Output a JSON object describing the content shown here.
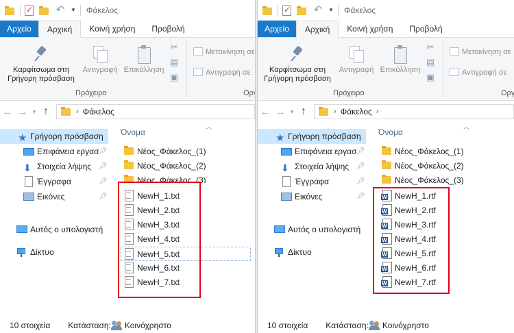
{
  "windows": [
    {
      "id": "left",
      "title": "Φάκελος",
      "tabs": [
        "Αρχείο",
        "Αρχική",
        "Κοινή χρήση",
        "Προβολή"
      ],
      "ribbon": {
        "pin_line1": "Καρφίτσωμα στη",
        "pin_line2": "Γρήγορη πρόσβαση",
        "copy": "Αντιγραφή",
        "paste": "Επικόλληση",
        "move_to": "Μετακίνηση σε",
        "copy_to": "Αντιγραφή σε",
        "group_clipboard": "Πρόχειρο",
        "group_organize": "Οργ"
      },
      "address": {
        "crumb": "Φάκελος",
        "trailing_chevron": false
      },
      "nav": [
        {
          "label": "Γρήγορη πρόσβαση",
          "icon": "star-icon",
          "pinned": false,
          "selected": true
        },
        {
          "label": "Επιφάνεια εργασ",
          "icon": "desktop-icon",
          "pinned": true
        },
        {
          "label": "Στοιχεία λήψης",
          "icon": "download-icon",
          "pinned": true
        },
        {
          "label": "Έγγραφα",
          "icon": "documents-icon",
          "pinned": true
        },
        {
          "label": "Εικόνες",
          "icon": "pictures-icon",
          "pinned": true
        },
        {
          "label": "Αυτός ο υπολογιστή",
          "icon": "computer-icon",
          "pinned": false
        },
        {
          "label": "Δίκτυο",
          "icon": "network-icon",
          "pinned": false
        }
      ],
      "column_header": "Όνομα",
      "folders": [
        "Νέος_Φάκελος_(1)",
        "Νέος_Φάκελος_(2)",
        "Νέος_Φάκελος_(3)"
      ],
      "files": [
        "NewH_1.txt",
        "NewH_2.txt",
        "NewH_3.txt",
        "NewH_4.txt",
        "NewH_5.txt",
        "NewH_6.txt",
        "NewH_7.txt"
      ],
      "file_icon": "text-file-icon",
      "status": {
        "count": "10 στοιχεία",
        "state_label": "Κατάσταση:",
        "state_value": "Κοινόχρηστο"
      }
    },
    {
      "id": "right",
      "title": "Φάκελος",
      "tabs": [
        "Αρχείο",
        "Αρχική",
        "Κοινή χρήση",
        "Προβολή"
      ],
      "ribbon": {
        "pin_line1": "Καρφίτσωμα στη",
        "pin_line2": "Γρήγορη πρόσβαση",
        "copy": "Αντιγραφή",
        "paste": "Επικόλληση",
        "move_to": "Μετακίνηση σε",
        "copy_to": "Αντιγραφή σε",
        "group_clipboard": "Πρόχειρο",
        "group_organize": "Οργ"
      },
      "address": {
        "crumb": "Φάκελος",
        "trailing_chevron": true
      },
      "nav": [
        {
          "label": "Γρήγορη πρόσβαση",
          "icon": "star-icon",
          "pinned": false,
          "selected": true
        },
        {
          "label": "Επιφάνεια εργασ",
          "icon": "desktop-icon",
          "pinned": true
        },
        {
          "label": "Στοιχεία λήψης",
          "icon": "download-icon",
          "pinned": true
        },
        {
          "label": "Έγγραφα",
          "icon": "documents-icon",
          "pinned": true
        },
        {
          "label": "Εικόνες",
          "icon": "pictures-icon",
          "pinned": true
        },
        {
          "label": "Αυτός ο υπολογιστή",
          "icon": "computer-icon",
          "pinned": false
        },
        {
          "label": "Δίκτυο",
          "icon": "network-icon",
          "pinned": false
        }
      ],
      "column_header": "Όνομα",
      "folders": [
        "Νέος_Φάκελος_(1)",
        "Νέος_Φάκελος_(2)",
        "Νέος_Φάκελος_(3)"
      ],
      "files": [
        "NewH_1.rtf",
        "NewH_2.rtf",
        "NewH_3.rtf",
        "NewH_4.rtf",
        "NewH_5.rtf",
        "NewH_6.rtf",
        "NewH_7.rtf"
      ],
      "file_icon": "word-rtf-icon",
      "status": {
        "count": "10 στοιχεία",
        "state_label": "Κατάσταση:",
        "state_value": "Κοινόχρηστο"
      }
    }
  ],
  "colors": {
    "file_tab": "#1979ca",
    "highlight_box": "#e0001a",
    "selection": "#cce8ff",
    "folder": "#f4c340"
  }
}
